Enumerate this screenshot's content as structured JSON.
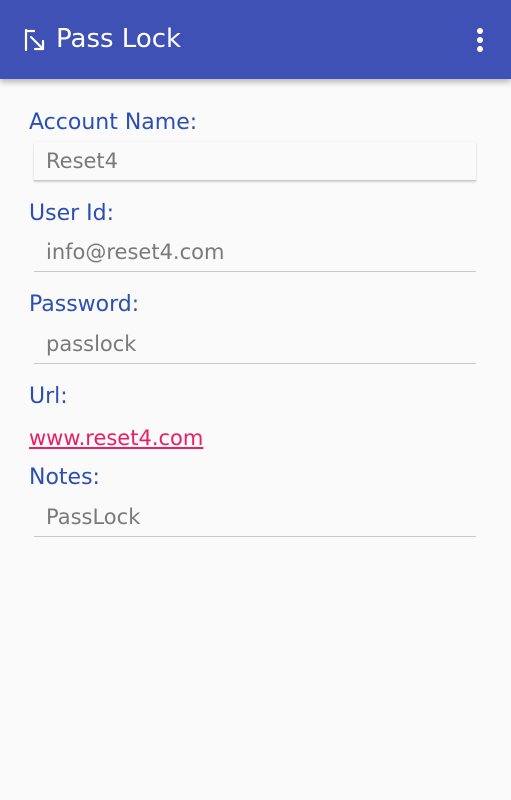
{
  "app": {
    "title": "Pass Lock",
    "back_icon": "back-arrow-icon",
    "menu_icon": "more-vert-icon",
    "toolbar_color": "#3f51b5"
  },
  "form": {
    "account_name": {
      "label": "Account Name:",
      "value": "Reset4"
    },
    "user_id": {
      "label": "User Id:",
      "value": "info@reset4.com"
    },
    "password": {
      "label": "Password:",
      "value": "passlock"
    },
    "url": {
      "label": "Url:",
      "value": "www.reset4.com"
    },
    "notes": {
      "label": "Notes:",
      "value": "PassLock"
    }
  },
  "colors": {
    "label": "#2c4fb3",
    "value": "#7a7a7a",
    "link": "#e91e63",
    "background": "#fafafa"
  }
}
